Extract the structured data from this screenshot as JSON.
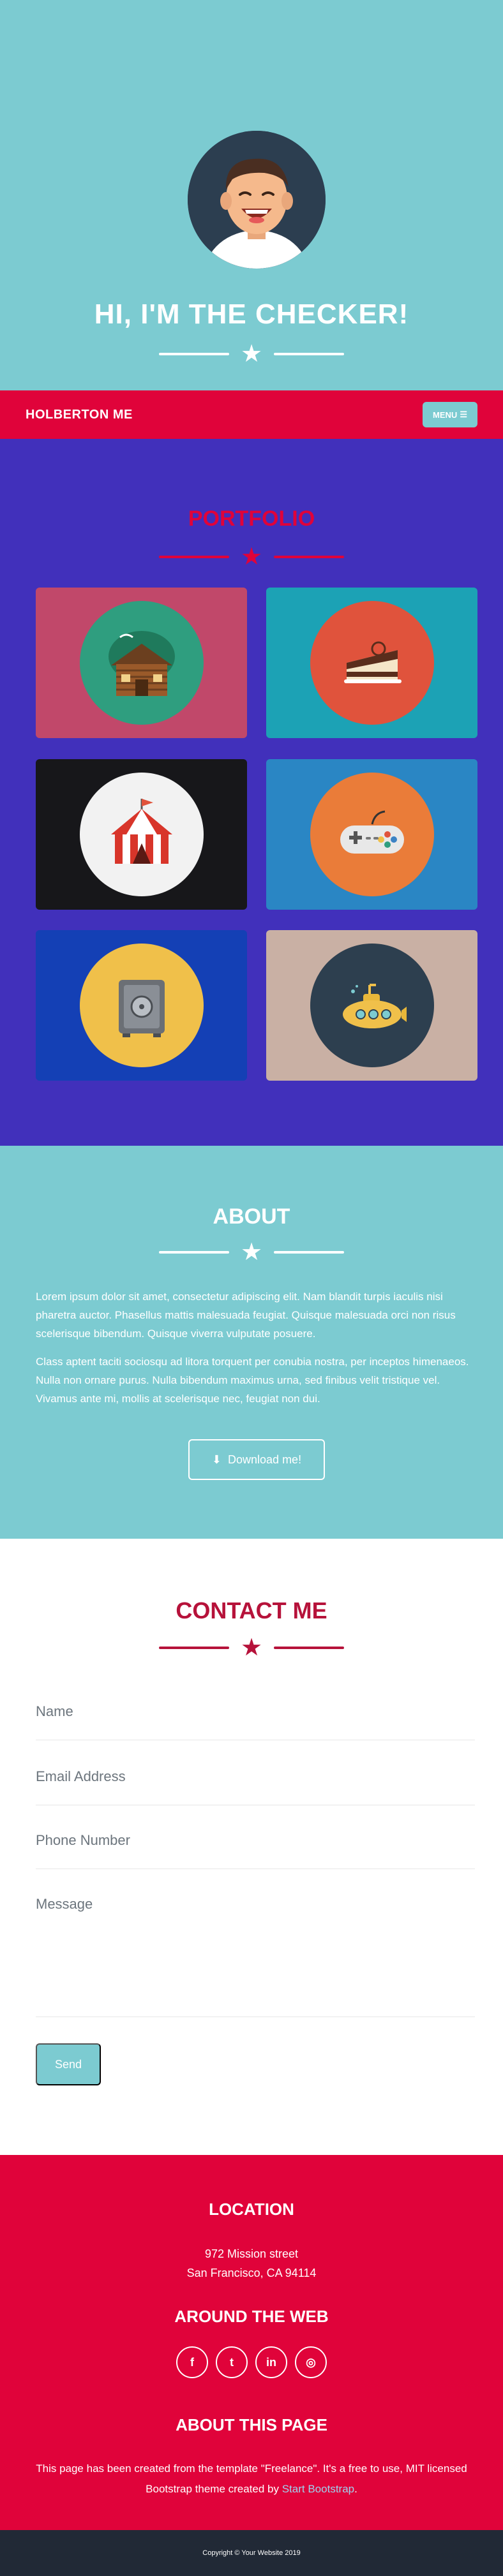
{
  "masthead": {
    "title": "HI, I'M THE CHECKER!",
    "avatar_icon": "smiling-boy-avatar"
  },
  "navbar": {
    "brand": "HOLBERTON ME",
    "menu_label": "MENU",
    "menu_icon": "hamburger-icon"
  },
  "portfolio": {
    "title": "PORTFOLIO",
    "items": [
      {
        "icon": "log-cabin-icon",
        "bg": "#c1486a",
        "circle": "#2f9e7f"
      },
      {
        "icon": "cake-slice-icon",
        "bg": "#1ca2b5",
        "circle": "#e0533c"
      },
      {
        "icon": "circus-tent-icon",
        "bg": "#17171a",
        "circle": "#f2f2f2"
      },
      {
        "icon": "game-controller-icon",
        "bg": "#2a86c4",
        "circle": "#ea7c39"
      },
      {
        "icon": "safe-icon",
        "bg": "#1440b5",
        "circle": "#f0c04a"
      },
      {
        "icon": "submarine-icon",
        "bg": "#c9b0a4",
        "circle": "#2d3f4f"
      }
    ]
  },
  "about": {
    "title": "ABOUT",
    "paragraph_1": "Lorem ipsum dolor sit amet, consectetur adipiscing elit. Nam blandit turpis iaculis nisi pharetra auctor. Phasellus mattis malesuada feugiat. Quisque malesuada orci non risus scelerisque bibendum. Quisque viverra vulputate posuere.",
    "paragraph_2": "Class aptent taciti sociosqu ad litora torquent per conubia nostra, per inceptos himenaeos. Nulla non ornare purus. Nulla bibendum maximus urna, sed finibus velit tristique vel. Vivamus ante mi, mollis at scelerisque nec, feugiat non dui.",
    "download_label": "Download me!",
    "download_icon": "download-icon"
  },
  "contact": {
    "title": "CONTACT ME",
    "fields": {
      "name": "Name",
      "email": "Email Address",
      "phone": "Phone Number",
      "message": "Message"
    },
    "send_label": "Send"
  },
  "footer": {
    "location_title": "LOCATION",
    "address_line_1": "972 Mission street",
    "address_line_2": "San Francisco, CA 94114",
    "web_title": "AROUND THE WEB",
    "socials": [
      {
        "icon": "facebook-icon",
        "glyph": "f"
      },
      {
        "icon": "twitter-icon",
        "glyph": "t"
      },
      {
        "icon": "linkedin-icon",
        "glyph": "in"
      },
      {
        "icon": "dribbble-icon",
        "glyph": "◎"
      }
    ],
    "about_title": "ABOUT THIS PAGE",
    "about_text_1": "This page has been created from the template \"Freelance\". It's a free to use, MIT licensed Bootstrap theme created by ",
    "about_link": "Start Bootstrap",
    "about_text_2": ".",
    "copyright": "Copyright © Your Website 2019"
  },
  "colors": {
    "teal": "#7ccbd1",
    "red": "#e0033a",
    "purple": "#4130bb",
    "dark": "#212936"
  }
}
